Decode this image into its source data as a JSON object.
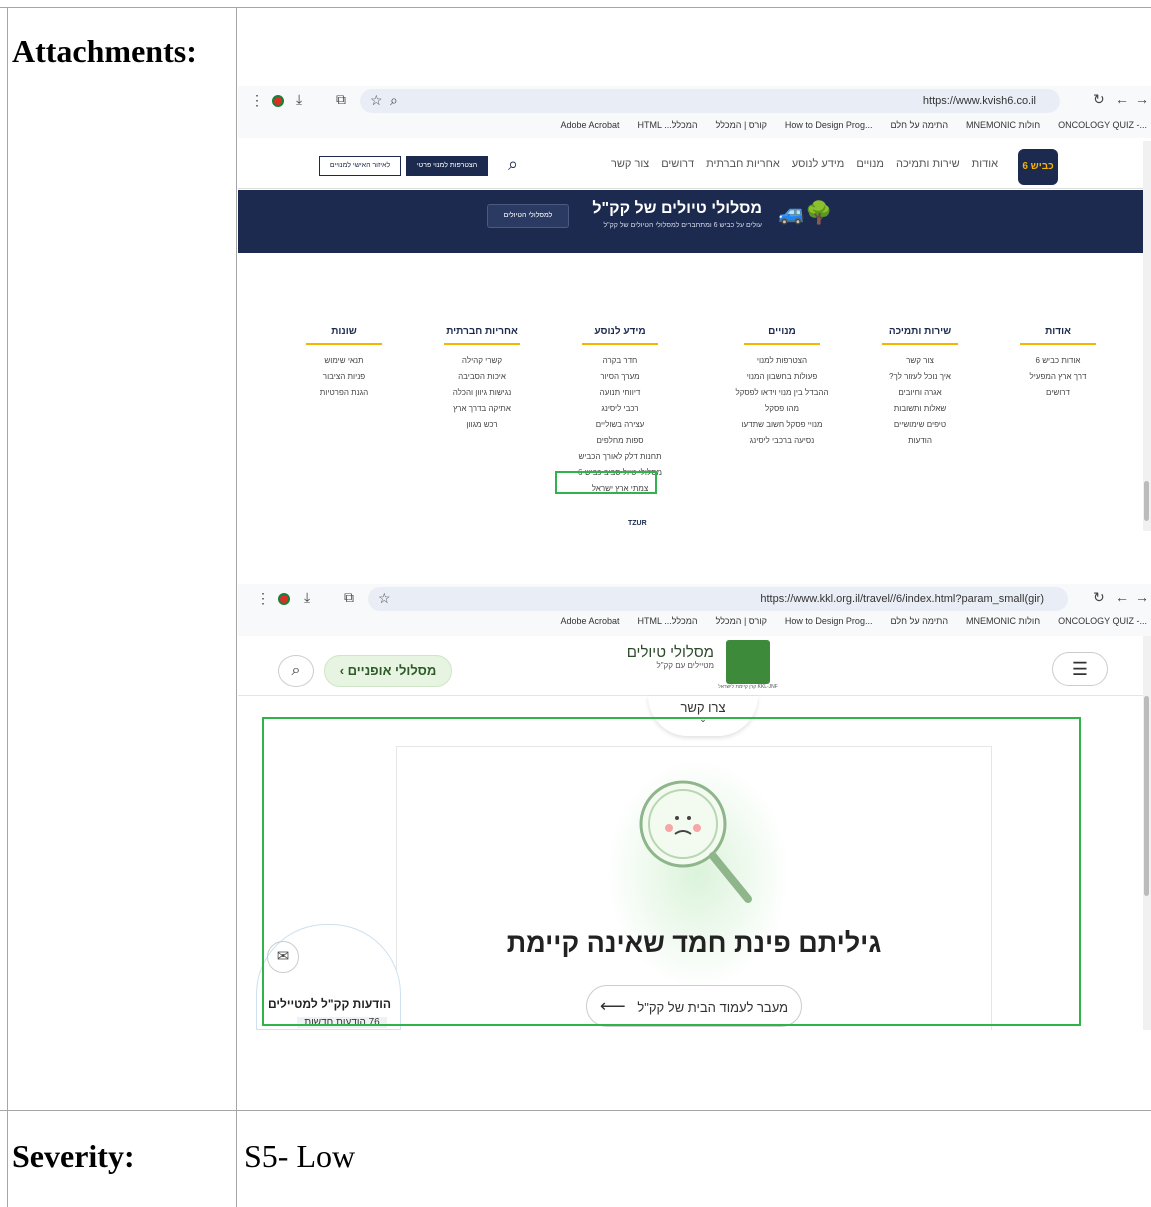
{
  "labels": {
    "attachments": "Attachments:",
    "severity": "Severity:"
  },
  "severity_value": "S5- Low",
  "shot1": {
    "url": "https://www.kvish6.co.il",
    "bookmarks": [
      "Adobe Acrobat",
      "HTML ...המכלל",
      "קורס | המכלל",
      "How to Design Prog...",
      "התימה על חלם",
      "MNEMONIC חולות",
      "ONCOLOGY QUIZ -..."
    ],
    "nav_items": [
      "אודות",
      "שירות ותמיכה",
      "מנויים",
      "מידע לנוסע",
      "אחריות חברתית",
      "דרושים",
      "צור קשר"
    ],
    "btn_register": "הצטרפות למנוי פרטי",
    "btn_personal": "לאיזור האישי למנויים",
    "logo_text": "כביש 6",
    "banner_title": "מסלולי טיולים של קק\"ל",
    "banner_sub": "עולים על כביש 6 ומתחברים למסלולי הטיולים של קק\"ל",
    "banner_btn": "למסלולי הטיולים",
    "footer_cols": [
      {
        "title": "אודות",
        "items": [
          "אודות כביש 6",
          "דרך ארץ המפעיל",
          "דרושים"
        ]
      },
      {
        "title": "שירות ותמיכה",
        "items": [
          "צור קשר",
          "איך נוכל לעזור לך?",
          "אגרה וחיובים",
          "שאלות ותשובות",
          "טיפים שימושיים",
          "הודעות"
        ]
      },
      {
        "title": "מנויים",
        "items": [
          "הצטרפות למנוי",
          "פעולות בחשבון המנוי",
          "ההבדל בין מנוי וידאו לפסקל",
          "מהו פסקל",
          "מנויי פסקל חשוב שתדעו",
          "נסיעה ברכבי ליסינג"
        ]
      },
      {
        "title": "מידע לנוסע",
        "items": [
          "חדר בקרה",
          "מערך הסיור",
          "דיווחי תנועה",
          "רכבי ליסינג",
          "עצירה בשוליים",
          "ספות מחלפים",
          "תחנות דלק לאורך הכביש",
          "מסלולי טיול סביב כביש 6",
          "צמתי ארץ ישראל"
        ]
      },
      {
        "title": "אחריות חברתית",
        "items": [
          "קשרי קהילה",
          "איכות הסביבה",
          "נגישות גיוון והכלה",
          "אתיקה בדרך ארץ",
          "רכש מגוון"
        ]
      },
      {
        "title": "שונות",
        "items": [
          "תנאי שימוש",
          "פניות הציבור",
          "הגנת הפרטיות"
        ]
      }
    ],
    "credit": "TZUR"
  },
  "shot2": {
    "url": "https://www.kkl.org.il/travel//6/index.html?param_small(gir)",
    "bookmarks": [
      "Adobe Acrobat",
      "HTML ...המכלל",
      "קורס | המכלל",
      "How to Design Prog...",
      "התימה על חלם",
      "MNEMONIC חולות",
      "ONCOLOGY QUIZ -..."
    ],
    "site_title": "מסלולי טיולים",
    "site_sub": "מטיילים עם קק\"ל",
    "logo_caption": "קרן קיימת לישראל KKL-JNF",
    "bike_btn": "מסלולי אופניים ›",
    "contact": "צרו קשר",
    "error_title": "גיליתם פינת חמד שאינה קיימת",
    "home_btn": "מעבר לעמוד הבית של קק\"ל",
    "updates_title": "הודעות קק\"ל למטיילים",
    "updates_count": "76 הודעות חדשות"
  },
  "colors": {
    "green_highlight": "#2fb34a",
    "navy": "#1c2a4f",
    "accent_yellow": "#f4b400"
  }
}
